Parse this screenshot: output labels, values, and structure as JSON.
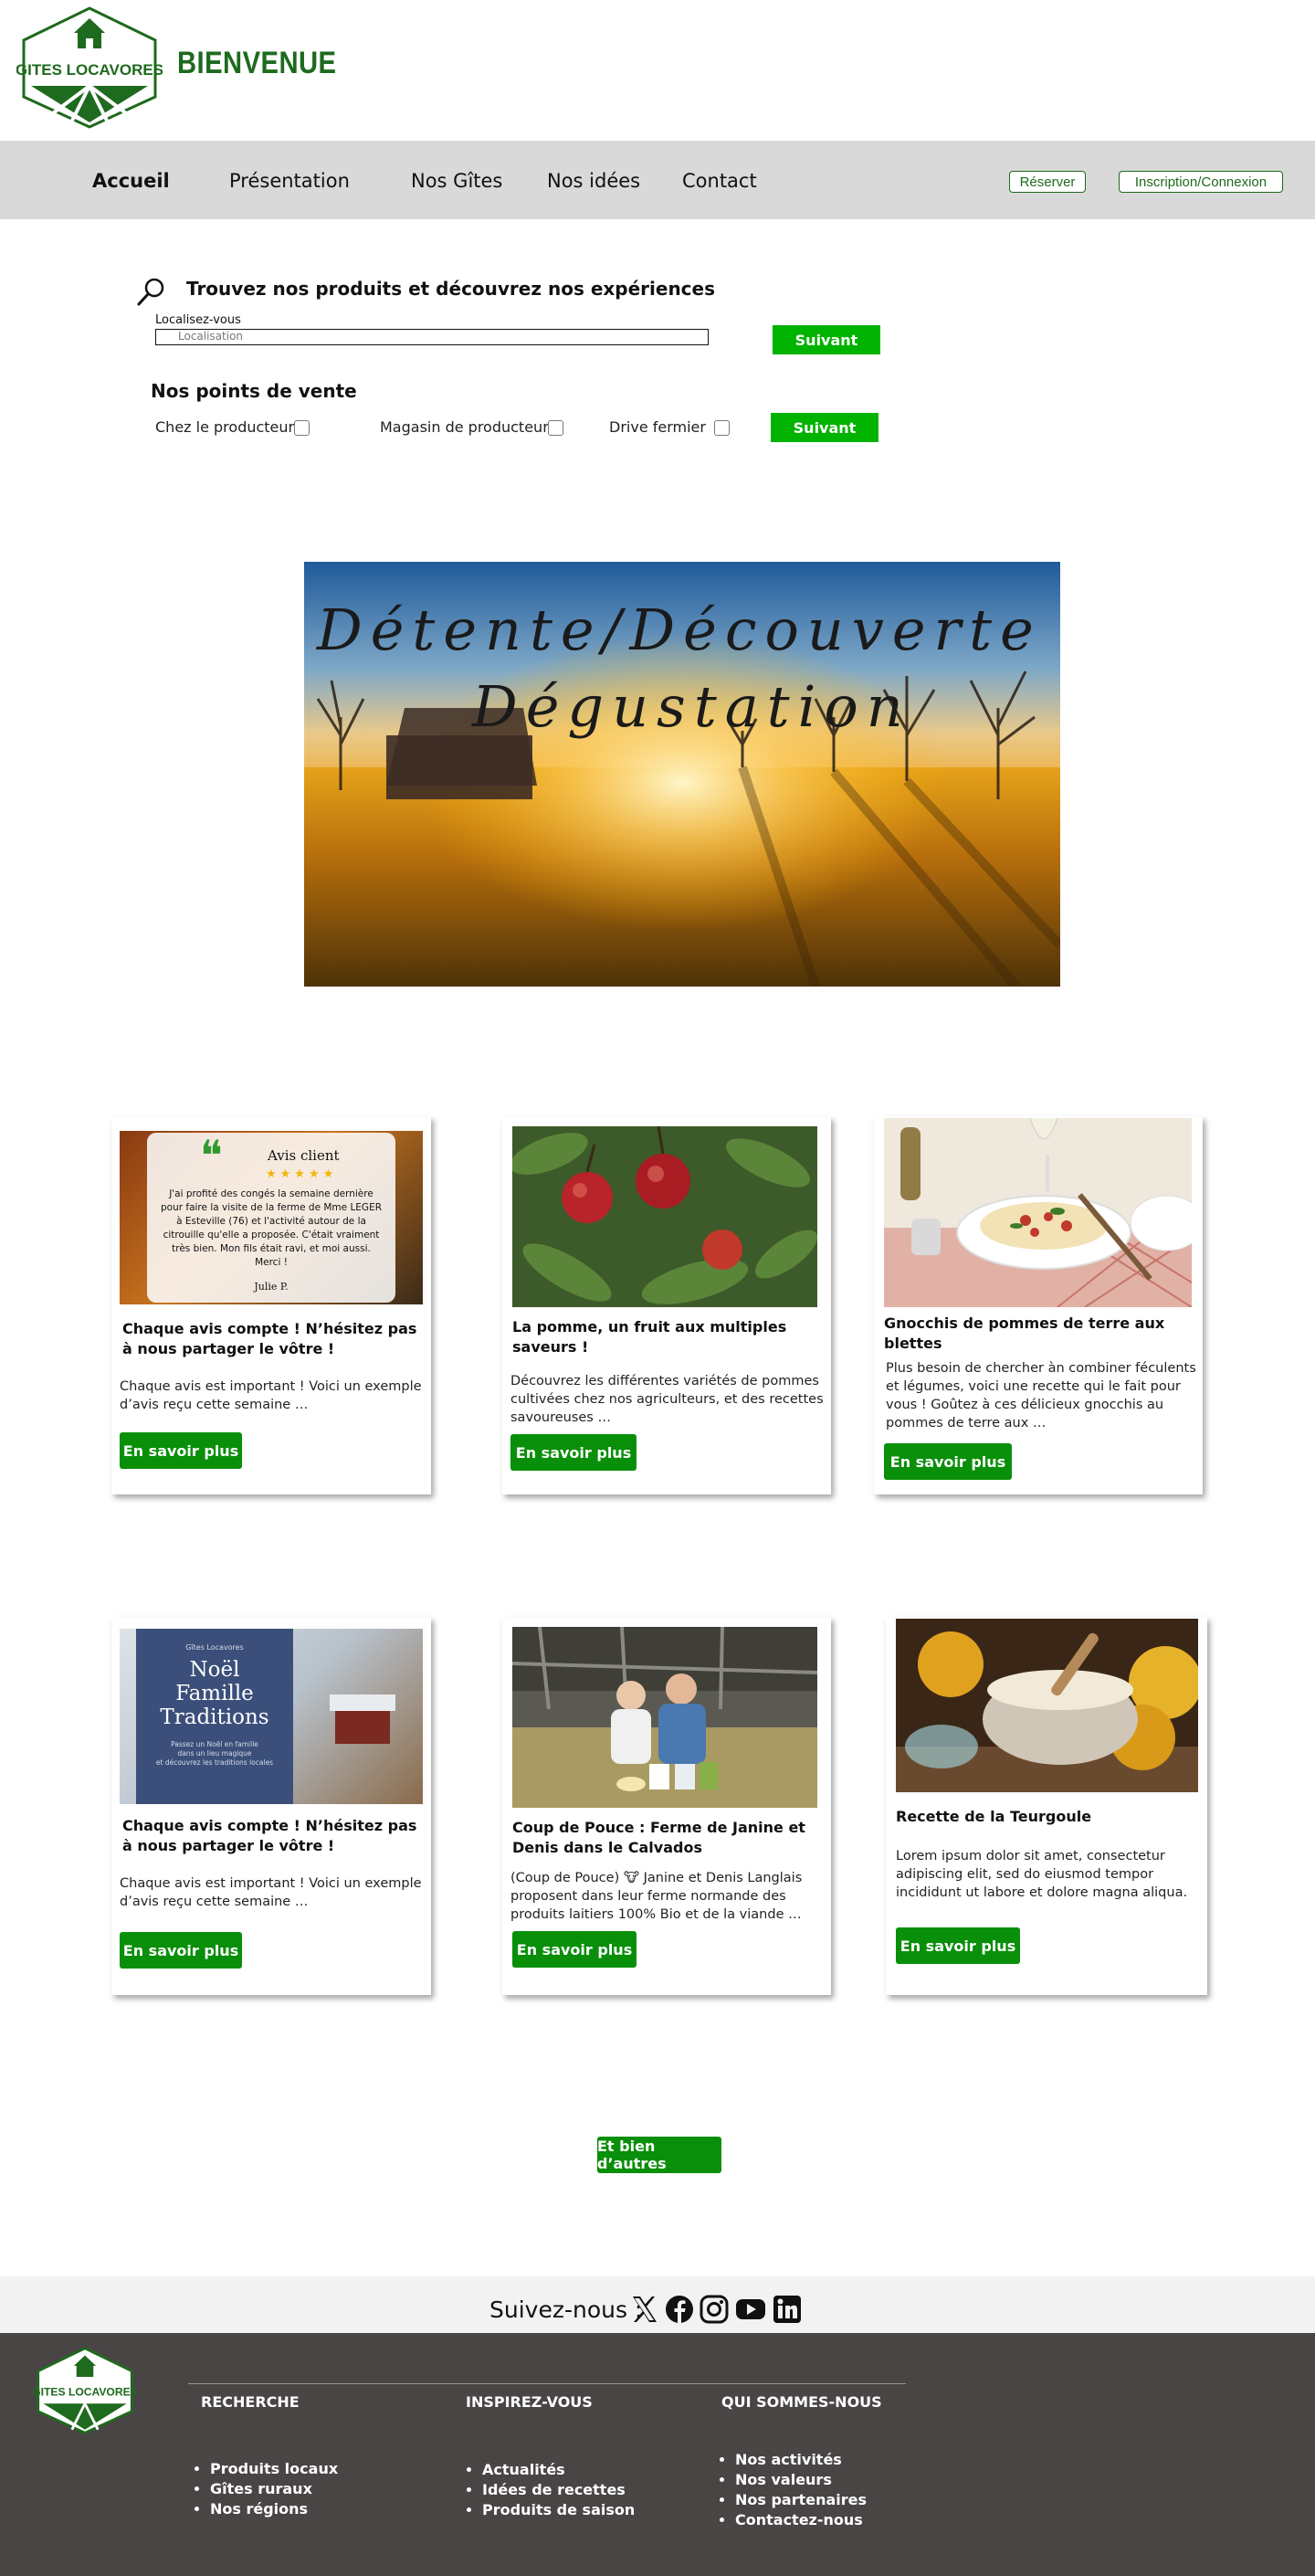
{
  "header": {
    "logo_text": "GITES LOCAVORES",
    "welcome": "BIENVENUE"
  },
  "nav": {
    "items": [
      "Accueil",
      "Présentation",
      "Nos Gîtes",
      "Nos idées",
      "Contact"
    ],
    "active": "Accueil",
    "reserve_label": "Réserver",
    "login_label": "Inscription/Connexion"
  },
  "search": {
    "title": "Trouvez nos produits et découvrez nos expériences",
    "location_label": "Localisez-vous",
    "location_placeholder": "Localisation",
    "next_label": "Suivant"
  },
  "points_vente": {
    "title": "Nos points de vente",
    "options": [
      "Chez le producteur",
      "Magasin de producteur",
      "Drive fermier"
    ],
    "next_label": "Suivant"
  },
  "hero": {
    "line1": "Détente/Découverte",
    "line2": "Dégustation"
  },
  "cards": [
    {
      "title": "Chaque avis compte ! N’hésitez pas à nous partager le vôtre !",
      "text": "Chaque avis est important ! Voici un exemple d’avis reçu cette semaine …",
      "button": "En savoir plus",
      "review": {
        "heading": "Avis client",
        "stars": 5,
        "body": "J'ai profité des congés la semaine dernière pour faire la visite de la ferme de Mme LEGER à Esteville (76) et l'activité autour de la citrouille qu'elle a proposée. C'était vraiment très bien. Mon fils était ravi, et moi aussi. Merci !",
        "author": "Julie P."
      }
    },
    {
      "title": "La pomme, un fruit aux multiples saveurs !",
      "text": "Découvrez les différentes variétés de pommes cultivées chez nos agriculteurs, et des recettes savoureuses …",
      "button": "En savoir plus"
    },
    {
      "title": "Gnocchis de pommes de terre aux blettes",
      "text": "Plus besoin de chercher àn combiner féculents et légumes, voici une recette qui le fait pour vous ! Goûtez à ces délicieux gnocchis au pommes de terre aux …",
      "button": "En savoir plus"
    },
    {
      "title": "Chaque avis compte ! N’hésitez pas à nous partager le vôtre !",
      "text": "Chaque avis est important ! Voici un exemple d’avis reçu cette semaine …",
      "button": "En savoir plus",
      "poster": {
        "small": "Gîtes Locavores",
        "line1": "Noël",
        "line2": "Famille",
        "line3": "Traditions",
        "sub1": "Passez un Noël en famille",
        "sub2": "dans un lieu magique",
        "sub3": "et découvrez les traditions locales"
      }
    },
    {
      "title": "Coup de Pouce : Ferme de Janine et Denis dans le Calvados",
      "text": "(Coup de Pouce) 🐮 Janine et Denis Langlais proposent dans leur ferme normande des produits laitiers 100% Bio et de la viande …",
      "button": "En savoir plus"
    },
    {
      "title": "Recette de la Teurgoule",
      "text": "Lorem ipsum dolor sit amet, consectetur adipiscing elit, sed do eiusmod tempor incididunt ut labore et dolore magna aliqua.",
      "button": "En savoir plus"
    }
  ],
  "more_button": "Et bien d’autres",
  "follow": {
    "label": "Suivez-nous :",
    "icons": [
      "x-icon",
      "facebook-icon",
      "instagram-icon",
      "youtube-icon",
      "linkedin-icon"
    ]
  },
  "footer": {
    "columns": [
      {
        "title": "RECHERCHE",
        "items": [
          "Produits locaux",
          "Gîtes ruraux",
          "Nos régions"
        ]
      },
      {
        "title": "INSPIREZ-VOUS",
        "items": [
          "Actualités",
          "Idées de recettes",
          "Produits de saison"
        ]
      },
      {
        "title": "QUI SOMMES-NOUS",
        "items": [
          "Nos activités",
          "Nos valeurs",
          "Nos partenaires",
          "Contactez-nous"
        ]
      }
    ]
  },
  "colors": {
    "brand_green": "#1e6a1e",
    "button_green": "#00b300",
    "card_button_green": "#0a8f0a",
    "navbar_bg": "#d9d9d9",
    "footer_bg": "#4a4545"
  }
}
